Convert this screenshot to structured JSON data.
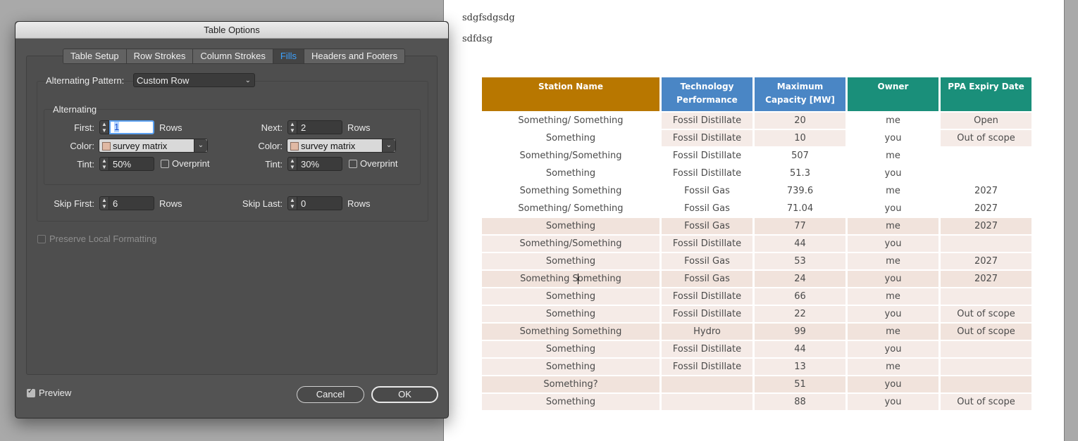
{
  "document": {
    "lines": [
      "sdgfsdgsdg",
      "sdfdsg"
    ],
    "table": {
      "headers": [
        "Station Name",
        "Technology Performance",
        "Maximum Capacity [MW]",
        "Owner",
        "PPA Expiry Date"
      ],
      "header_colors": [
        "#b87700",
        "#4a86c5",
        "#4a86c5",
        "#1a8f7a",
        "#1a8f7a"
      ],
      "rows": [
        [
          "Something/ Something",
          "Fossil Distillate",
          "20",
          "me",
          "Open"
        ],
        [
          "Something",
          "Fossil Distillate",
          "10",
          "you",
          "Out of scope"
        ],
        [
          "Something/Something",
          "Fossil Distillate",
          "507",
          "me",
          ""
        ],
        [
          "Something",
          "Fossil Distillate",
          "51.3",
          "you",
          ""
        ],
        [
          "Something Something",
          "Fossil Gas",
          "739.6",
          "me",
          "2027"
        ],
        [
          "Something/ Something",
          "Fossil Gas",
          "71.04",
          "you",
          "2027"
        ],
        [
          "Something",
          "Fossil Gas",
          "77",
          "me",
          "2027"
        ],
        [
          "Something/Something",
          "Fossil Distillate",
          "44",
          "you",
          ""
        ],
        [
          "Something",
          "Fossil Gas",
          "53",
          "me",
          "2027"
        ],
        [
          "Something Something",
          "Fossil Gas",
          "24",
          "you",
          "2027"
        ],
        [
          "Something",
          "Fossil Distillate",
          "66",
          "me",
          ""
        ],
        [
          "Something",
          "Fossil Distillate",
          "22",
          "you",
          "Out of scope"
        ],
        [
          "Something Something",
          "Hydro",
          "99",
          "me",
          "Out of scope"
        ],
        [
          "Something",
          "Fossil Distillate",
          "44",
          "you",
          ""
        ],
        [
          "Something",
          "Fossil Distillate",
          "13",
          "me",
          ""
        ],
        [
          "Something?",
          "",
          "51",
          "you",
          ""
        ],
        [
          "Something",
          "",
          "88",
          "you",
          "Out of scope"
        ]
      ]
    }
  },
  "dialog": {
    "title": "Table Options",
    "tabs": [
      "Table Setup",
      "Row Strokes",
      "Column Strokes",
      "Fills",
      "Headers and Footers"
    ],
    "selected_tab": "Fills",
    "alternating_pattern_label": "Alternating Pattern:",
    "alternating_pattern_value": "Custom Row",
    "alternating_group_label": "Alternating",
    "first_label": "First:",
    "first_value": "1",
    "next_label": "Next:",
    "next_value": "2",
    "rows_unit": "Rows",
    "color_label": "Color:",
    "first_color": "survey matrix",
    "next_color": "survey matrix",
    "swatch_color": "#e0b9a4",
    "tint_label": "Tint:",
    "first_tint": "50%",
    "next_tint": "30%",
    "overprint_label": "Overprint",
    "skip_first_label": "Skip First:",
    "skip_first_value": "6",
    "skip_last_label": "Skip Last:",
    "skip_last_value": "0",
    "preserve_label": "Preserve Local Formatting",
    "preview_label": "Preview",
    "cancel_label": "Cancel",
    "ok_label": "OK"
  }
}
